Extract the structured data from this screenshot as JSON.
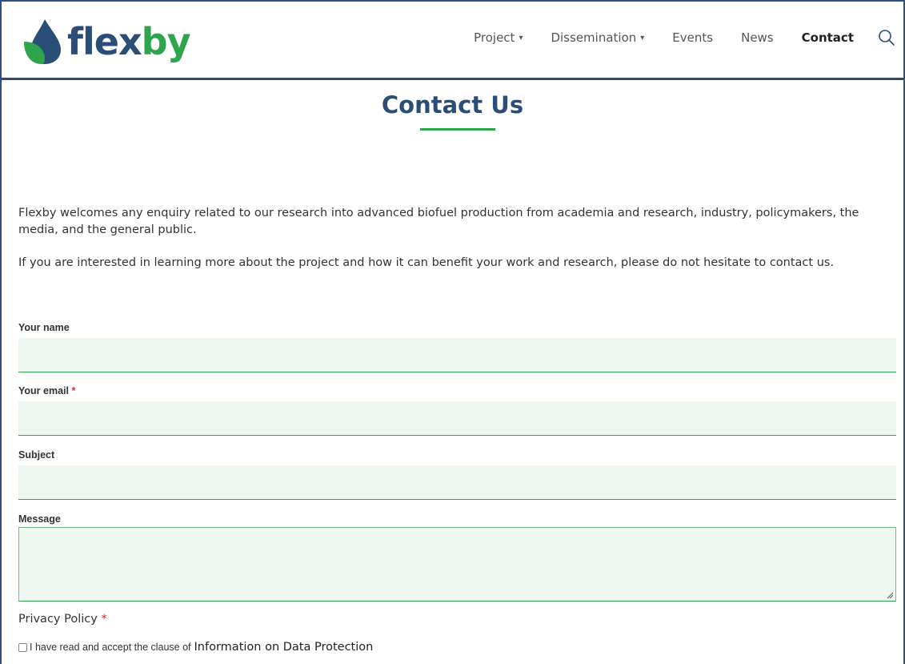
{
  "brand": {
    "part1": "flex",
    "part2": "by"
  },
  "nav": {
    "items": [
      {
        "label": "Project",
        "dropdown": true
      },
      {
        "label": "Dissemination",
        "dropdown": true
      },
      {
        "label": "Events",
        "dropdown": false
      },
      {
        "label": "News",
        "dropdown": false
      },
      {
        "label": "Contact",
        "dropdown": false,
        "active": true
      }
    ],
    "caret": "▾"
  },
  "page": {
    "title": "Contact Us"
  },
  "intro": {
    "p1": "Flexby welcomes any enquiry related to our research into advanced biofuel production from academia and research, industry, policymakers, the media, and the general public.",
    "p2": "If you are interested in learning more about the project and how it can benefit your work and research, please do not hesitate to contact us."
  },
  "form": {
    "name_label": "Your name",
    "email_label": "Your email",
    "required_mark": "*",
    "subject_label": "Subject",
    "message_label": "Message",
    "privacy_title": "Privacy Policy",
    "consent_text": "I have read and accept the clause of",
    "consent_link": "Information on Data Protection",
    "name_value": "",
    "email_value": "",
    "subject_value": "",
    "message_value": ""
  },
  "colors": {
    "brand_blue": "#2b4e77",
    "brand_green": "#2ea44f",
    "field_bg": "#eef8f1",
    "required": "#d22f2f"
  },
  "icons": {
    "search": "search-icon",
    "logo": "leaf-drop-logo-icon",
    "resize": "resize-handle-icon"
  }
}
